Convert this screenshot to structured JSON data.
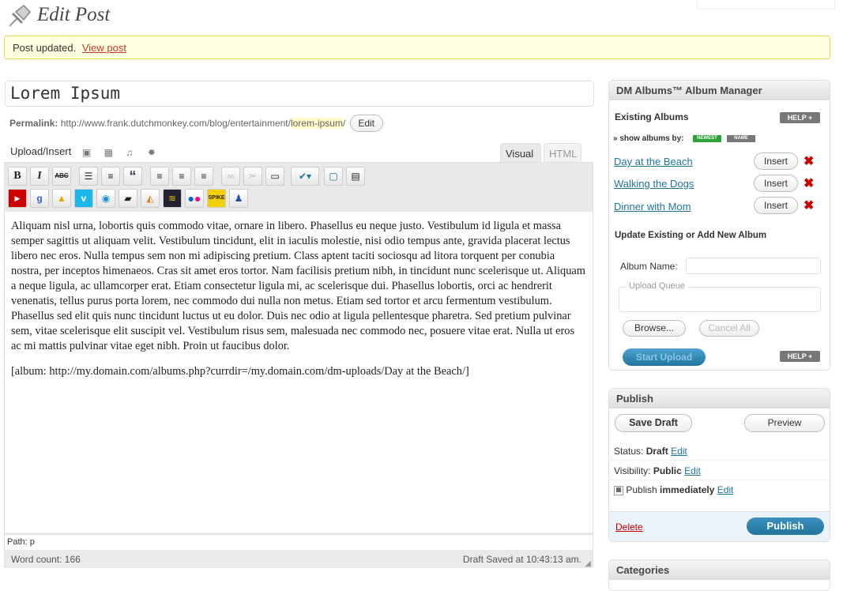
{
  "header": {
    "title": "Edit Post"
  },
  "notice": {
    "text": "Post updated.",
    "link": "View post"
  },
  "post": {
    "title": "Lorem Ipsum",
    "permalink_label": "Permalink:",
    "permalink_base": "http://www.frank.dutchmonkey.com/blog/entertainment/",
    "permalink_slug": "lorem-ipsum",
    "permalink_tail": "/",
    "edit_label": "Edit"
  },
  "upload": {
    "label": "Upload/Insert"
  },
  "tabs": {
    "visual": "Visual",
    "html": "HTML"
  },
  "toolbar": {
    "bold": "B",
    "italic": "I",
    "strike": "ABC"
  },
  "editor": {
    "paragraph1": "Aliquam nisl urna, lobortis quis commodo vitae, ornare in libero. Phasellus eu neque justo. Vestibulum id ligula et massa semper sagittis ut aliquam velit. Vestibulum tincidunt, elit in iaculis molestie, nisi odio tempus ante, gravida placerat lectus libero nec eros. Nulla tempus sem non mi adipiscing pretium. Class aptent taciti sociosqu ad litora torquent per conubia nostra, per inceptos himenaeos. Cras sit amet eros tortor. Nam facilisis pretium nibh, in tincidunt nunc scelerisque ut. Aliquam a neque ligula, ac ullamcorper erat. Etiam consectetur ligula mi, ac scelerisque dui. Phasellus lobortis, orci ac hendrerit venenatis, tellus purus porta lorem, nec commodo dui nulla non metus. Etiam sed tortor et arcu fermentum vestibulum. Phasellus sed elit quis nunc tincidunt luctus ut eu dolor. Duis nec odio at ligula pellentesque pharetra. Sed pretium pulvinar sem, vitae scelerisque elit suscipit vel. Vestibulum risus sem, malesuada nec commodo nec, posuere vitae erat. Nulla ut eros ac mi mattis pulvinar vitae eget nibh. Proin ut faucibus dolor.",
    "paragraph2": "[album: http://my.domain.com/albums.php?currdir=/my.domain.com/dm-uploads/Day at the Beach/]",
    "path": "Path: p",
    "word_count": "Word count: 166",
    "draft_saved": "Draft Saved at 10:43:13 am."
  },
  "albums": {
    "title": "DM Albums™ Album Manager",
    "existing_label": "Existing Albums",
    "help": "HELP +",
    "show_by": "» show albums by:",
    "sort_newest": "NEWEST",
    "sort_name": "NAME",
    "items": [
      {
        "name": "Day at the Beach",
        "insert": "Insert"
      },
      {
        "name": "Walking the Dogs",
        "insert": "Insert"
      },
      {
        "name": "Dinner with Mom",
        "insert": "Insert"
      }
    ],
    "update_label": "Update Existing or Add New Album",
    "album_name_label": "Album Name:",
    "upload_queue": "Upload Queue",
    "browse": "Browse...",
    "cancel_all": "Cancel All",
    "start_upload": "Start Upload"
  },
  "publish": {
    "title": "Publish",
    "save_draft": "Save Draft",
    "preview": "Preview",
    "status_label": "Status:",
    "status_value": "Draft",
    "visibility_label": "Visibility:",
    "visibility_value": "Public",
    "publish_label": "Publish",
    "publish_value": "immediately",
    "edit": "Edit",
    "delete": "Delete",
    "publish_button": "Publish"
  },
  "categories": {
    "title": "Categories"
  },
  "colors": {
    "accent": "#21759b",
    "notice_bg": "#ffffe0",
    "delete": "#cc0000",
    "publish_button": "#21759b"
  }
}
